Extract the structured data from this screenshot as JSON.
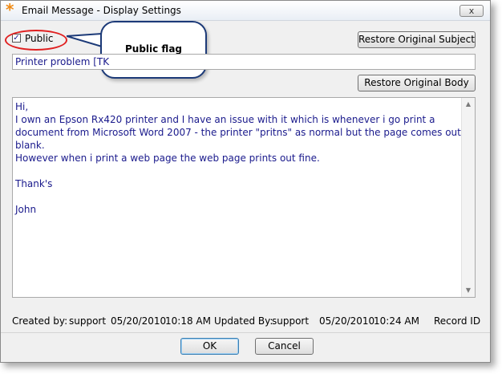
{
  "window": {
    "title": "Email Message - Display Settings",
    "icon": "asterisk-app-icon",
    "close_label": "x"
  },
  "public_checkbox": {
    "label": "Public",
    "checked": true
  },
  "callout": {
    "text": "Public flag"
  },
  "buttons": {
    "restore_subject": "Restore Original Subject",
    "restore_body": "Restore Original Body",
    "ok": "OK",
    "cancel": "Cancel"
  },
  "subject": {
    "value": "Printer problem [TK"
  },
  "body": {
    "lines": [
      "Hi,",
      "I own an Epson Rx420 printer and I have an issue with it which is whenever i go print a",
      "document from Microsoft Word 2007  - the printer \"pritns\" as normal but the page comes out",
      "blank.",
      "However when i print a web page the web page prints out  fine.",
      "",
      "Thank's",
      "",
      "John"
    ]
  },
  "status": {
    "created_label": "Created by:",
    "created_user": "support",
    "created_date": "05/20/2010",
    "created_time": "10:18 AM",
    "updated_label": "Updated By:",
    "updated_user": "support",
    "updated_date": "05/20/2010",
    "updated_time": "10:24 AM",
    "record_label": "Record ID"
  },
  "colors": {
    "text_blue": "#1a1a8c",
    "highlight_red": "#e02020",
    "callout_border": "#1c3a78"
  }
}
